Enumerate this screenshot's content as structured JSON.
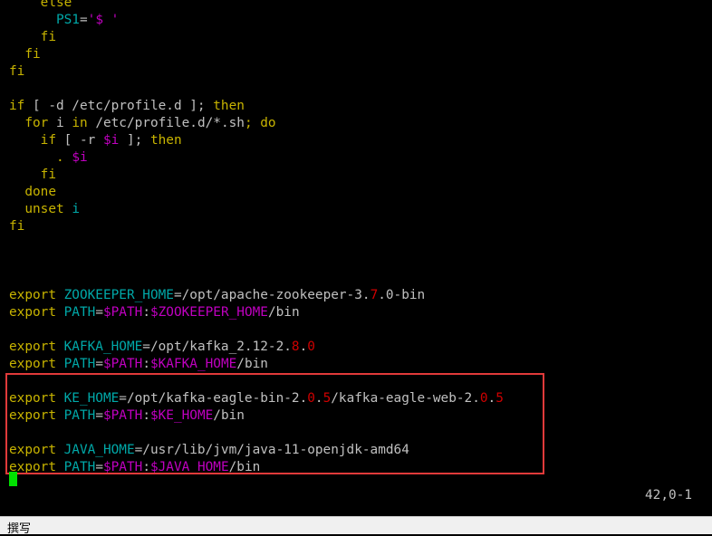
{
  "editor": {
    "lines": [
      [
        {
          "t": "    ",
          "c": "w"
        },
        {
          "t": "else",
          "c": "y"
        }
      ],
      [
        {
          "t": "      ",
          "c": "w"
        },
        {
          "t": "PS1",
          "c": "c"
        },
        {
          "t": "=",
          "c": "w"
        },
        {
          "t": "'$ '",
          "c": "m"
        }
      ],
      [
        {
          "t": "    ",
          "c": "w"
        },
        {
          "t": "fi",
          "c": "y"
        }
      ],
      [
        {
          "t": "  ",
          "c": "w"
        },
        {
          "t": "fi",
          "c": "y"
        }
      ],
      [
        {
          "t": "fi",
          "c": "y"
        }
      ],
      [],
      [
        {
          "t": "if",
          "c": "y"
        },
        {
          "t": " [ -d /etc/profile.d ]; ",
          "c": "w"
        },
        {
          "t": "then",
          "c": "y"
        }
      ],
      [
        {
          "t": "  ",
          "c": "w"
        },
        {
          "t": "for",
          "c": "y"
        },
        {
          "t": " i ",
          "c": "w"
        },
        {
          "t": "in",
          "c": "y"
        },
        {
          "t": " /etc/profile.d/*.sh",
          "c": "w"
        },
        {
          "t": "; ",
          "c": "y"
        },
        {
          "t": "do",
          "c": "y"
        }
      ],
      [
        {
          "t": "    ",
          "c": "w"
        },
        {
          "t": "if",
          "c": "y"
        },
        {
          "t": " [ -r ",
          "c": "w"
        },
        {
          "t": "$i",
          "c": "m"
        },
        {
          "t": " ]; ",
          "c": "w"
        },
        {
          "t": "then",
          "c": "y"
        }
      ],
      [
        {
          "t": "      ",
          "c": "w"
        },
        {
          "t": ". ",
          "c": "y"
        },
        {
          "t": "$i",
          "c": "m"
        }
      ],
      [
        {
          "t": "    ",
          "c": "w"
        },
        {
          "t": "fi",
          "c": "y"
        }
      ],
      [
        {
          "t": "  ",
          "c": "w"
        },
        {
          "t": "done",
          "c": "y"
        }
      ],
      [
        {
          "t": "  ",
          "c": "w"
        },
        {
          "t": "unset",
          "c": "y"
        },
        {
          "t": " i",
          "c": "c"
        }
      ],
      [
        {
          "t": "fi",
          "c": "y"
        }
      ],
      [],
      [],
      [],
      [
        {
          "t": "export",
          "c": "y"
        },
        {
          "t": " ZOOKEEPER_HOME",
          "c": "c"
        },
        {
          "t": "=/opt/apache-zookeeper-3.",
          "c": "w"
        },
        {
          "t": "7",
          "c": "r"
        },
        {
          "t": ".0-bin",
          "c": "w"
        }
      ],
      [
        {
          "t": "export",
          "c": "y"
        },
        {
          "t": " PATH",
          "c": "c"
        },
        {
          "t": "=",
          "c": "w"
        },
        {
          "t": "$PATH",
          "c": "m"
        },
        {
          "t": ":",
          "c": "w"
        },
        {
          "t": "$ZOOKEEPER_HOME",
          "c": "m"
        },
        {
          "t": "/bin",
          "c": "w"
        }
      ],
      [],
      [
        {
          "t": "export",
          "c": "y"
        },
        {
          "t": " KAFKA_HOME",
          "c": "c"
        },
        {
          "t": "=/opt/kafka_2.12-2.",
          "c": "w"
        },
        {
          "t": "8",
          "c": "r"
        },
        {
          "t": ".",
          "c": "w"
        },
        {
          "t": "0",
          "c": "r"
        }
      ],
      [
        {
          "t": "export",
          "c": "y"
        },
        {
          "t": " PATH",
          "c": "c"
        },
        {
          "t": "=",
          "c": "w"
        },
        {
          "t": "$PATH",
          "c": "m"
        },
        {
          "t": ":",
          "c": "w"
        },
        {
          "t": "$KAFKA_HOME",
          "c": "m"
        },
        {
          "t": "/bin",
          "c": "w"
        }
      ],
      [],
      [
        {
          "t": "export",
          "c": "y"
        },
        {
          "t": " KE_HOME",
          "c": "c"
        },
        {
          "t": "=/opt/kafka-eagle-bin-2.",
          "c": "w"
        },
        {
          "t": "0",
          "c": "r"
        },
        {
          "t": ".",
          "c": "w"
        },
        {
          "t": "5",
          "c": "r"
        },
        {
          "t": "/kafka-eagle-web-2.",
          "c": "w"
        },
        {
          "t": "0",
          "c": "r"
        },
        {
          "t": ".",
          "c": "w"
        },
        {
          "t": "5",
          "c": "r"
        }
      ],
      [
        {
          "t": "export",
          "c": "y"
        },
        {
          "t": " PATH",
          "c": "c"
        },
        {
          "t": "=",
          "c": "w"
        },
        {
          "t": "$PATH",
          "c": "m"
        },
        {
          "t": ":",
          "c": "w"
        },
        {
          "t": "$KE_HOME",
          "c": "m"
        },
        {
          "t": "/bin",
          "c": "w"
        }
      ],
      [],
      [
        {
          "t": "export",
          "c": "y"
        },
        {
          "t": " JAVA_HOME",
          "c": "c"
        },
        {
          "t": "=/usr/lib/jvm/java-11-openjdk-amd64",
          "c": "w"
        }
      ],
      [
        {
          "t": "export",
          "c": "y"
        },
        {
          "t": " PATH",
          "c": "c"
        },
        {
          "t": "=",
          "c": "w"
        },
        {
          "t": "$PATH",
          "c": "m"
        },
        {
          "t": ":",
          "c": "w"
        },
        {
          "t": "$JAVA_HOME",
          "c": "m"
        },
        {
          "t": "/bin",
          "c": "w"
        }
      ]
    ],
    "cursor_position": "42,0-1"
  },
  "statusbar": {
    "mode_label": "撰写"
  },
  "colors": {
    "background": "#000000",
    "keyword": "#c8b400",
    "identifier": "#00a8a8",
    "variable": "#c000c0",
    "number": "#d00000",
    "text": "#c0c0c0",
    "highlight_box": "#e03a3a",
    "cursor": "#00e000"
  }
}
